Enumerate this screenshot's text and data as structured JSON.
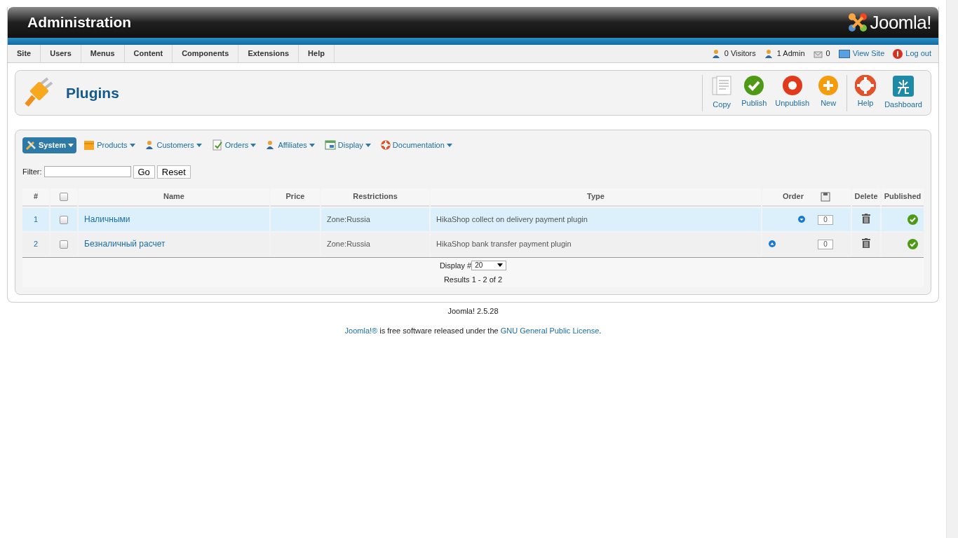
{
  "header": {
    "title": "Administration",
    "logo": "Joomla!"
  },
  "menu": [
    {
      "label": "Site"
    },
    {
      "label": "Users"
    },
    {
      "label": "Menus"
    },
    {
      "label": "Content"
    },
    {
      "label": "Components"
    },
    {
      "label": "Extensions"
    },
    {
      "label": "Help"
    }
  ],
  "status": [
    {
      "kind": "visitors",
      "label": "0 Visitors",
      "link": false
    },
    {
      "kind": "admin",
      "label": "1 Admin",
      "link": false
    },
    {
      "kind": "messages",
      "label": "0",
      "link": false
    },
    {
      "kind": "viewsite",
      "label": "View Site",
      "link": true
    },
    {
      "kind": "logout",
      "label": "Log out",
      "link": true
    }
  ],
  "page_title": "Plugins",
  "toolbar": [
    {
      "kind": "copy",
      "label": "Copy"
    },
    {
      "kind": "publish",
      "label": "Publish"
    },
    {
      "kind": "unpublish",
      "label": "Unpublish"
    },
    {
      "kind": "new",
      "label": "New"
    },
    {
      "kind": "help",
      "label": "Help"
    },
    {
      "kind": "dashboard",
      "label": "Dashboard"
    }
  ],
  "submenu": [
    {
      "kind": "system",
      "label": "System",
      "selected": true
    },
    {
      "kind": "products",
      "label": "Products",
      "selected": false
    },
    {
      "kind": "customers",
      "label": "Customers",
      "selected": false
    },
    {
      "kind": "orders",
      "label": "Orders",
      "selected": false
    },
    {
      "kind": "affiliates",
      "label": "Affiliates",
      "selected": false
    },
    {
      "kind": "display",
      "label": "Display",
      "selected": false
    },
    {
      "kind": "documentation",
      "label": "Documentation",
      "selected": false
    }
  ],
  "filter": {
    "label": "Filter:",
    "go": "Go",
    "reset": "Reset"
  },
  "table": {
    "select_all_checked": false,
    "columns": [
      "#",
      "Name",
      "Price",
      "Restrictions",
      "Type",
      "Order",
      "Delete",
      "Published"
    ],
    "rows": [
      {
        "num": "1",
        "checked": false,
        "selected": true,
        "name": "Наличными",
        "restrictions": "Zone:Russia",
        "type": "HikaShop collect on delivery payment plugin",
        "kind": "move_down",
        "order": "0",
        "published": true
      },
      {
        "num": "2",
        "checked": false,
        "selected": false,
        "name": "Безналичный расчет",
        "restrictions": "Zone:Russia",
        "type": "HikaShop bank transfer payment plugin",
        "kind": "move_up",
        "order": "0",
        "published": true
      }
    ]
  },
  "pagination": {
    "display_label": "Display #",
    "display_value": "20",
    "results": "Results 1 - 2 of 2"
  },
  "footer": {
    "version": "Joomla! 2.5.28",
    "license": [
      {
        "text": "Joomla!®",
        "link": true
      },
      {
        "text": " is free software released under the ",
        "link": false
      },
      {
        "text": "GNU General Public License",
        "link": true
      },
      {
        "text": ".",
        "link": false
      }
    ]
  }
}
